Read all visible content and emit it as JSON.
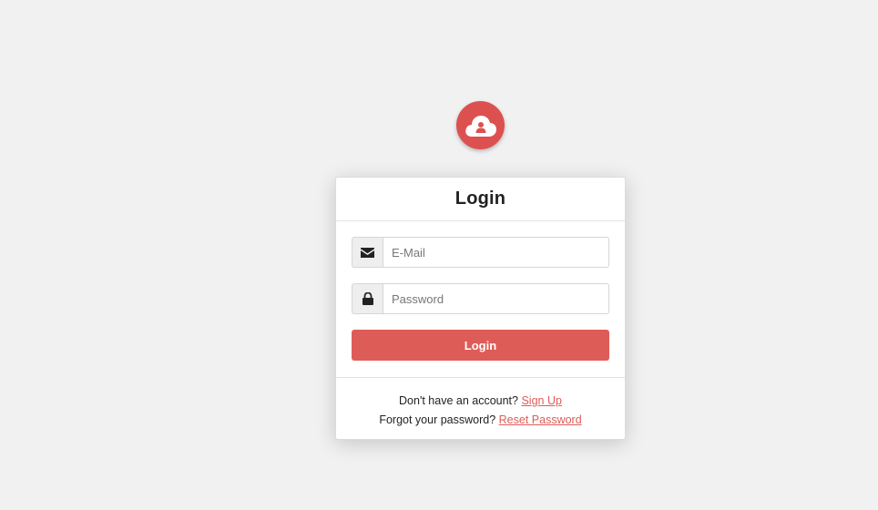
{
  "logo": {
    "icon": "cloud-user-icon",
    "color": "#dc514f"
  },
  "login_card": {
    "title": "Login",
    "email": {
      "icon": "envelope-icon",
      "placeholder": "E-Mail",
      "value": ""
    },
    "password": {
      "icon": "lock-icon",
      "placeholder": "Password",
      "value": ""
    },
    "submit_label": "Login",
    "accent_color": "#de5c57",
    "footer": {
      "signup_prompt": "Don't have an account?",
      "signup_link": "Sign Up",
      "reset_prompt": "Forgot your password?",
      "reset_link": "Reset Password"
    }
  }
}
